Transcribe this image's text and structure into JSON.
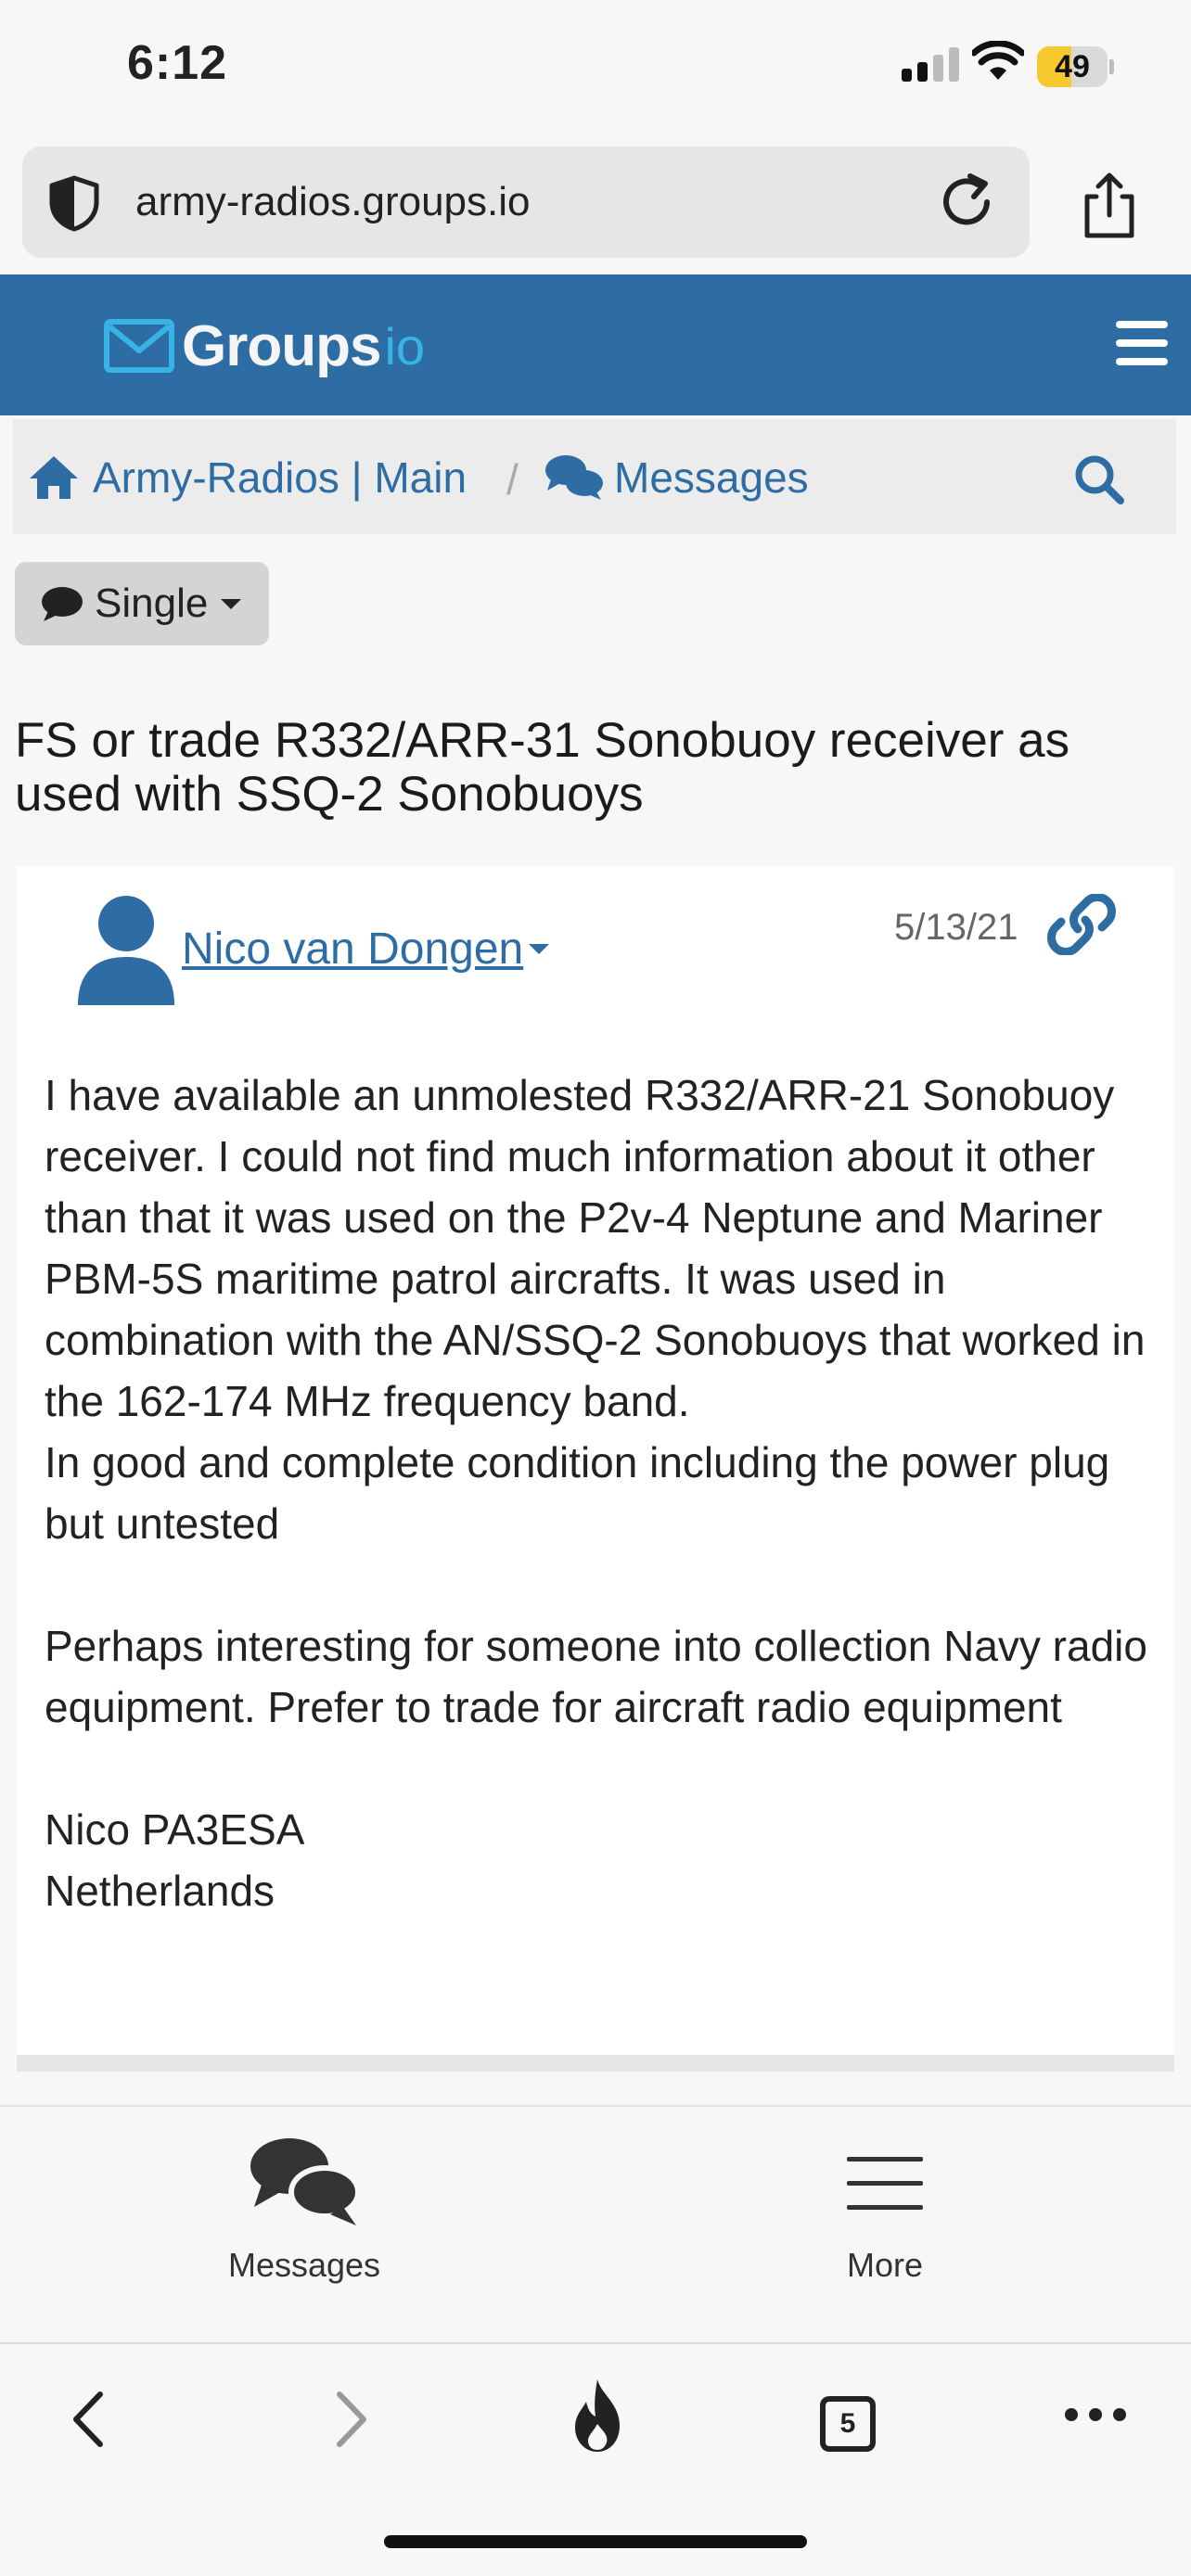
{
  "status_bar": {
    "time": "6:12",
    "battery": "49",
    "battery_level": 0.49
  },
  "browser": {
    "url": "army-radios.groups.io"
  },
  "groups_nav": {
    "logo_main": "Groups",
    "logo_suffix": "io"
  },
  "breadcrumb": {
    "home_label": "Army-Radios | Main",
    "separator": "/",
    "messages_label": "Messages"
  },
  "view_toggle": {
    "label": "Single"
  },
  "topic": {
    "title": "FS or trade R332/ARR-31 Sonobuoy receiver as used with SSQ-2 Sonobuoys"
  },
  "message": {
    "author": "Nico van Dongen",
    "date": "5/13/21",
    "body": [
      "I have available an unmolested R332/ARR-21 Sonobuoy receiver. I could not find much information about it other than that it was used on the P2v-4 Neptune and Mariner PBM-5S maritime patrol aircrafts. It was used in combination with the AN/SSQ-2 Sonobuoys that worked in the 162-174 MHz frequency band.",
      "In good and complete condition including the power plug but untested",
      "",
      "Perhaps interesting for someone into collection Navy radio equipment. Prefer to trade for aircraft radio equipment",
      "",
      "Nico PA3ESA",
      "Netherlands"
    ]
  },
  "tab_bar": {
    "messages_label": "Messages",
    "more_label": "More"
  },
  "safari_toolbar": {
    "tabs_count": "5"
  },
  "colors": {
    "brand_blue": "#2e6da4",
    "logo_accent": "#39b3e6",
    "battery_yellow": "#f6c92e"
  },
  "icons": [
    "shield-icon",
    "reload-icon",
    "share-icon",
    "envelope-logo-icon",
    "hamburger-icon",
    "home-icon",
    "comments-icon",
    "search-icon",
    "comment-icon",
    "user-icon",
    "link-icon",
    "back-icon",
    "forward-icon",
    "flame-icon",
    "tabs-icon",
    "more-dots-icon"
  ]
}
